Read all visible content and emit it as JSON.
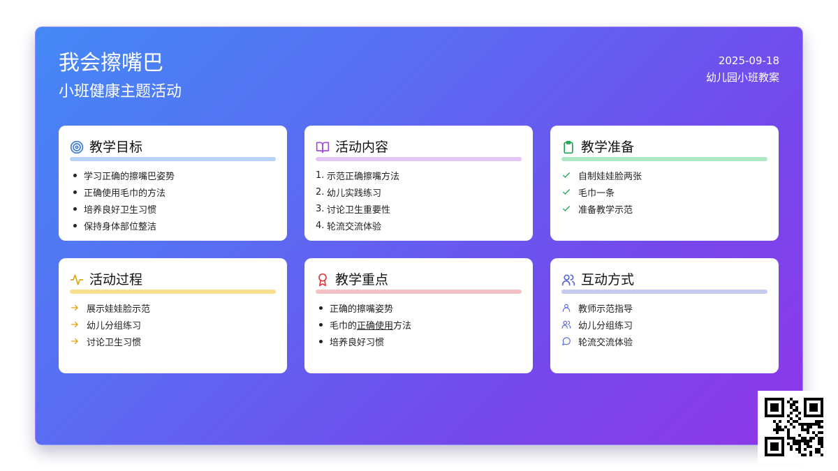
{
  "header": {
    "title": "我会擦嘴巴",
    "subtitle": "小班健康主题活动",
    "date": "2025-09-18",
    "plan_type": "幼儿园小班教案"
  },
  "cards": [
    {
      "title": "教学目标",
      "icon": "target-icon",
      "accent": "#b7d3f8",
      "icon_color": "#3b7be0",
      "list_style": "bullet",
      "items": [
        "学习正确的擦嘴巴姿势",
        "正确使用毛巾的方法",
        "培养良好卫生习惯",
        "保持身体部位整洁"
      ]
    },
    {
      "title": "活动内容",
      "icon": "book-open-icon",
      "accent": "#e2c7f4",
      "icon_color": "#a24ad9",
      "list_style": "numbered",
      "items": [
        "示范正确擦嘴方法",
        "幼儿实践练习",
        "讨论卫生重要性",
        "轮流交流体验"
      ],
      "numbers": [
        "1.",
        "2.",
        "3.",
        "4."
      ]
    },
    {
      "title": "教学准备",
      "icon": "clipboard-icon",
      "accent": "#aee8c3",
      "icon_color": "#22a456",
      "list_style": "check",
      "items": [
        "自制娃娃脸两张",
        "毛巾一条",
        "准备教学示范"
      ]
    },
    {
      "title": "活动过程",
      "icon": "activity-icon",
      "accent": "#f6e08e",
      "icon_color": "#d9a514",
      "list_style": "arrow",
      "items": [
        "展示娃娃脸示范",
        "幼儿分组练习",
        "讨论卫生习惯"
      ]
    },
    {
      "title": "教学重点",
      "icon": "award-icon",
      "accent": "#f3c1c4",
      "icon_color": "#dc3b3b",
      "list_style": "bullet",
      "items": [
        "正确的擦嘴姿势",
        "毛巾的正确使用方法",
        "培养良好习惯"
      ],
      "item2_parts": [
        "毛巾的",
        "正确使用",
        "方法"
      ]
    },
    {
      "title": "互动方式",
      "icon": "users-icon",
      "accent": "#c5cbef",
      "icon_color": "#5566d8",
      "list_style": "mixed-icons",
      "items": [
        "教师示范指导",
        "幼儿分组练习",
        "轮流交流体验"
      ],
      "item_icons": [
        "user-icon",
        "users-icon",
        "message-circle-icon"
      ]
    }
  ],
  "colors": {
    "gradient_start": "#4489f6",
    "gradient_end": "#8f36e8",
    "card_bg": "#ffffff",
    "text": "#111111"
  }
}
